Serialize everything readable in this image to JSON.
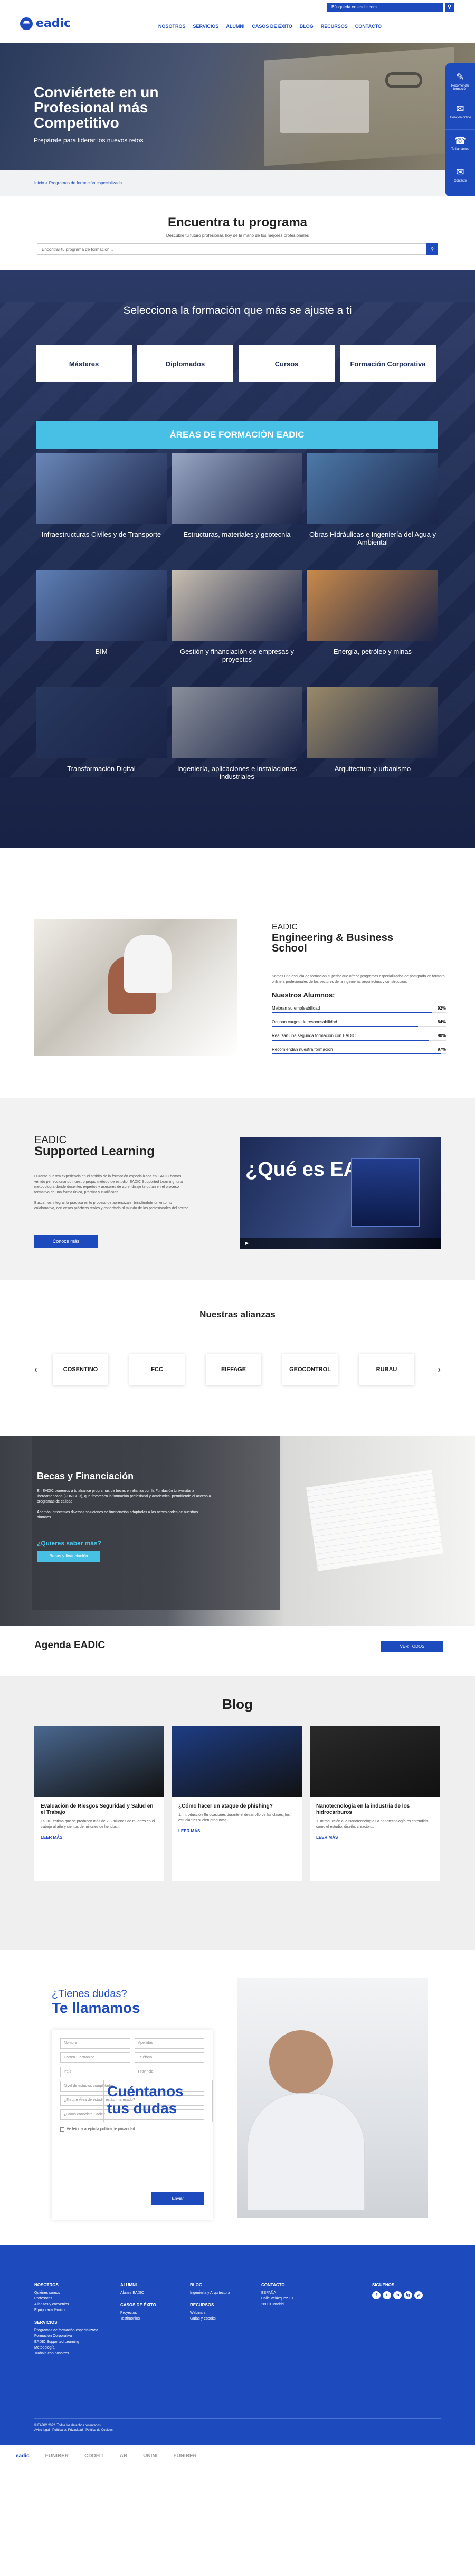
{
  "brand": {
    "name": "eadic"
  },
  "header": {
    "search_placeholder": "Búsqueda en eadic.com",
    "nav": [
      "NOSOTROS",
      "SERVICIOS",
      "ALUMNI",
      "CASOS DE ÉXITO",
      "BLOG",
      "RECURSOS",
      "CONTACTO"
    ]
  },
  "hero": {
    "title": "Conviértete en un Profesional más Competitivo",
    "subtitle": "Prepárate para liderar los nuevos retos"
  },
  "side_tools": [
    {
      "icon": "document-icon",
      "label": "Recomendar formación"
    },
    {
      "icon": "chat-icon",
      "label": "Atención online"
    },
    {
      "icon": "phone-icon",
      "label": "Te llamamos"
    },
    {
      "icon": "mail-icon",
      "label": "Contacto"
    }
  ],
  "breadcrumb": "Inicio > Programas de formación especializada",
  "finder": {
    "title": "Encuentra tu programa",
    "subtitle": "Descubre tu futuro profesional, hoy de la mano de los mejores profesionales",
    "placeholder": "Encontrar tu programa de formación..."
  },
  "formacion": {
    "title": "Selecciona la formación que más se ajuste a ti",
    "types": [
      "Másteres",
      "Diplomados",
      "Cursos",
      "Formación Corporativa"
    ],
    "areas_title": "ÁREAS DE FORMACIÓN EADIC",
    "areas": [
      {
        "label": "Infraestructuras Civiles y de Transporte",
        "color": "#6a87b8"
      },
      {
        "label": "Estructuras, materiales y geotecnia",
        "color": "#9aa7c4"
      },
      {
        "label": "Obras Hidráulicas e Ingeniería del Agua y Ambiental",
        "color": "#4d79a8"
      },
      {
        "label": "BIM",
        "color": "#5e7fb5"
      },
      {
        "label": "Gestión y financiación de empresas y proyectos",
        "color": "#c9c0b2"
      },
      {
        "label": "Energía, petróleo y minas",
        "color": "#c98a4a"
      },
      {
        "label": "Transformación Digital",
        "color": "#28385f"
      },
      {
        "label": "Ingeniería, aplicaciones e instalaciones industriales",
        "color": "#8a8f9a"
      },
      {
        "label": "Arquitectura y urbanismo",
        "color": "#9a8a68"
      }
    ]
  },
  "school": {
    "pre": "EADIC",
    "title": "Engineering & Business School",
    "description": "Somos una escuela de formación superior que ofrece programas especializados de postgrado en formato online a profesionales de los sectores de la ingeniería, arquitectura y construcción.",
    "stats_title": "Nuestros Alumnos:",
    "stats": [
      {
        "label": "Mejoran su empleabilidad",
        "value": 92,
        "display": "92%"
      },
      {
        "label": "Ocupan cargos de responsabilidad",
        "value": 84,
        "display": "84%"
      },
      {
        "label": "Realizan una segunda formación con EADIC",
        "value": 90,
        "display": "90%"
      },
      {
        "label": "Recomiendan nuestra formación",
        "value": 97,
        "display": "97%"
      }
    ]
  },
  "support": {
    "pre": "EADIC",
    "title": "Supported Learning",
    "p1": "Durante nuestra experiencia en el ámbito de la formación especializada en EADIC hemos venido perfeccionando nuestro propio método de estudio: EADIC Supported Learning, una metodología donde docentes expertos y asesores de aprendizaje te guían en el proceso formativo de una forma única, práctica y cualificada.",
    "p2": "Buscamos integrar la práctica en tu proceso de aprendizaje, brindándote un entorno colaborativo, con casos prácticos reales y conectado al mundo de los profesionales del sector.",
    "button": "Conoce más",
    "video_title": "¿Qué es EADIC?"
  },
  "allies": {
    "title": "Nuestras alianzas",
    "items": [
      "COSENTINO",
      "FCC",
      "EIFFAGE",
      "GEOCONTROL",
      "RUBAU"
    ]
  },
  "becas": {
    "title": "Becas y Financiación",
    "p1": "En EADIC ponemos a tu alcance programas de becas en alianza con la Fundación Universitaria Iberoamericana (FUNIBER), que favorecen la formación profesional y académica, permitiendo el acceso a programas de calidad.",
    "p2": "Además, ofrecemos diversas soluciones de financiación adaptadas a las necesidades de nuestros alumnos.",
    "question": "¿Quieres saber más?",
    "button": "Becas y financiación"
  },
  "agenda": {
    "title": "Agenda EADIC",
    "button": "VER TODOS"
  },
  "blog": {
    "title": "Blog",
    "posts": [
      {
        "title": "Evaluación de Riesgos Seguridad y Salud en el Trabajo",
        "excerpt": "La OIT estima que se producen más de 2,3 millones de muertes en el trabajo al año y cientos de millones de heridos...",
        "more": "LEER MÁS",
        "color": "#4a6890"
      },
      {
        "title": "¿Cómo hacer un ataque de phishing?",
        "excerpt": "1. Introducción   En ocasiones durante el desarrollo de las clases, los estudiantes suelen preguntar...",
        "more": "LEER MÁS",
        "color": "#1e3d85"
      },
      {
        "title": "Nanotecnología en la industria de los hidrocarburos",
        "excerpt": "1. Introducción a la Nanotecnología   La nanotecnología es entendida como el estudio, diseño, creación...",
        "more": "LEER MÁS",
        "color": "#2a2a2a"
      }
    ]
  },
  "call": {
    "ask": "¿Tienes dudas?",
    "title": "Te llamamos",
    "fields": [
      "Nombre",
      "Apellidos",
      "Correo Electrónico",
      "Teléfono",
      "País",
      "Provincia",
      "Nivel de estudios completados",
      "¿En qué Área de estudio estás interesado?",
      "¿Cómo conociste Eadic?",
      "Cuéntanos tus dudas"
    ],
    "consent": "He leído y acepto la política de privacidad",
    "send": "Enviar"
  },
  "footer": {
    "cols": [
      {
        "title": "NOSOTROS",
        "items": [
          "Quiénes somos",
          "Profesores",
          "Alianzas y convenios",
          "Equipo académico"
        ]
      },
      {
        "title": "ALUMNI",
        "items": [
          "Alumni EADIC"
        ]
      },
      {
        "title": "BLOG",
        "items": [
          "Ingeniería y Arquitectura"
        ]
      },
      {
        "title": "CONTACTO",
        "items": [
          "ESPAÑA",
          "Calle Velázquez 10",
          "28001 Madrid"
        ]
      },
      {
        "title": "SIGUENOS",
        "items": []
      }
    ],
    "services": {
      "title": "SERVICIOS",
      "items": [
        "Programas de formación especializada",
        "Formación Corporativa",
        "EADIC Supported Learning",
        "Metodología",
        "Trabaja con nosotros"
      ]
    },
    "casos": {
      "title": "CASOS DE ÉXITO",
      "items": [
        "Proyectos",
        "Testimonios"
      ]
    },
    "recursos": {
      "title": "RECURSOS",
      "items": [
        "Webinars",
        "Guías y ebooks"
      ]
    },
    "copyright": "© EADIC 2022. Todos los derechos reservados.",
    "legal": "Aviso legal - Política de Privacidad - Política de Cookies",
    "social": [
      "f",
      "t",
      "in",
      "ig",
      "yt"
    ],
    "partners": [
      "eadic",
      "FUNIBER",
      "CDDFIT",
      "AB",
      "UNINI",
      "FUNIBER"
    ]
  }
}
